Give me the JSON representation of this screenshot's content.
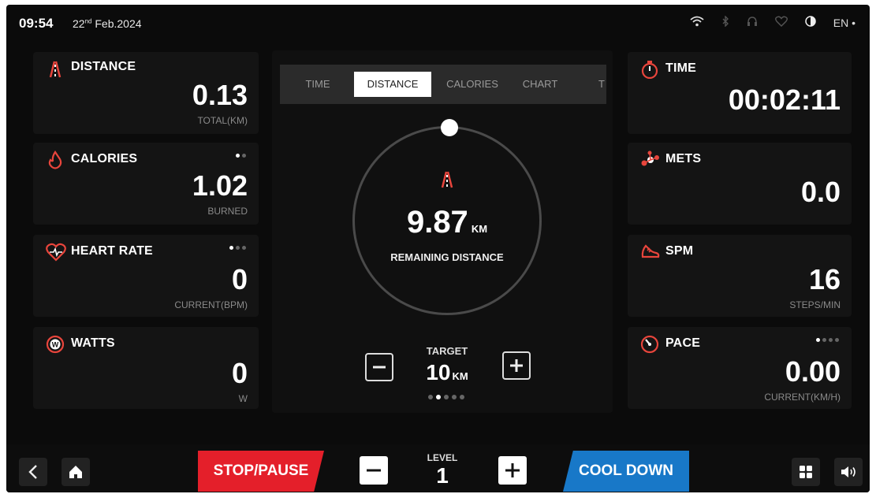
{
  "status": {
    "time": "09:54",
    "date_day": "22",
    "date_suffix": "nd",
    "date_rest": "Feb.2024",
    "language": "EN",
    "icons": [
      "wifi-icon",
      "bluetooth-icon",
      "headset-icon",
      "heart-monitor-icon",
      "contrast-icon"
    ]
  },
  "left_cards": {
    "distance": {
      "label": "DISTANCE",
      "value": "0.13",
      "unit": "TOTAL(KM)",
      "icon": "road-icon"
    },
    "calories": {
      "label": "CALORIES",
      "value": "1.02",
      "unit": "BURNED",
      "icon": "flame-icon"
    },
    "heart_rate": {
      "label": "HEART RATE",
      "value": "0",
      "unit": "CURRENT(BPM)",
      "icon": "heart-pulse-icon"
    },
    "watts": {
      "label": "WATTS",
      "value": "0",
      "unit": "W",
      "icon": "watts-icon"
    }
  },
  "right_cards": {
    "time": {
      "label": "TIME",
      "value": "00:02:11",
      "icon": "stopwatch-icon"
    },
    "mets": {
      "label": "METS",
      "value": "0.0",
      "icon": "mets-icon"
    },
    "spm": {
      "label": "SPM",
      "value": "16",
      "unit": "STEPS/MIN",
      "icon": "shoe-icon"
    },
    "pace": {
      "label": "PACE",
      "value": "0.00",
      "unit": "CURRENT(KM/H)",
      "icon": "gauge-icon"
    }
  },
  "center": {
    "tabs": [
      "TIME",
      "DISTANCE",
      "CALORIES",
      "CHART",
      "T"
    ],
    "active_tab": "DISTANCE",
    "remaining_value": "9.87",
    "remaining_unit": "KM",
    "remaining_label": "REMAINING DISTANCE",
    "target_label": "TARGET",
    "target_value": "10",
    "target_unit": "KM"
  },
  "bottom": {
    "stop_label": "STOP/PAUSE",
    "level_label": "LEVEL",
    "level_value": "1",
    "cool_down_label": "COOL DOWN"
  },
  "colors": {
    "stop": "#e41f2a",
    "cool_down": "#1878c8",
    "accent_icon": "#e8453c"
  }
}
